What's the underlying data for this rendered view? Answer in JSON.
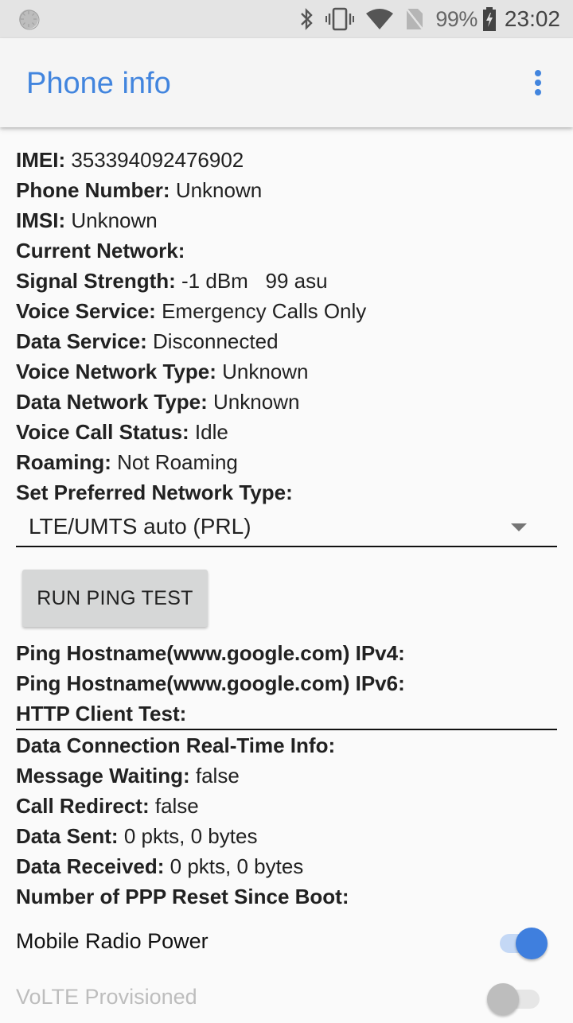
{
  "status_bar": {
    "left_icon": "sync-loading-icon",
    "icons": [
      "bluetooth-icon",
      "vibrate-icon",
      "wifi-icon",
      "no-sim-icon"
    ],
    "battery_percent": "99%",
    "battery_icon": "battery-charging-icon",
    "time": "23:02"
  },
  "app_bar": {
    "title": "Phone info",
    "overflow_icon": "more-vert-icon",
    "accent_color": "#4285de"
  },
  "info_rows": [
    {
      "label": "IMEI:",
      "value": "353394092476902"
    },
    {
      "label": "Phone Number:",
      "value": "Unknown"
    },
    {
      "label": "IMSI:",
      "value": "Unknown"
    },
    {
      "label": "Current Network:",
      "value": ""
    },
    {
      "label": "Signal Strength:",
      "value": "-1 dBm   99 asu"
    },
    {
      "label": "Voice Service:",
      "value": "Emergency Calls Only"
    },
    {
      "label": "Data Service:",
      "value": "Disconnected"
    },
    {
      "label": "Voice Network Type:",
      "value": "Unknown"
    },
    {
      "label": "Data Network Type:",
      "value": "Unknown"
    },
    {
      "label": "Voice Call Status:",
      "value": "Idle"
    },
    {
      "label": "Roaming:",
      "value": "Not Roaming"
    },
    {
      "label": "Set Preferred Network Type:",
      "value": ""
    }
  ],
  "preferred_network": {
    "selected": "LTE/UMTS auto (PRL)"
  },
  "ping_button": {
    "label": "RUN PING TEST"
  },
  "ping_rows": [
    {
      "label": "Ping Hostname(www.google.com) IPv4:",
      "value": ""
    },
    {
      "label": "Ping Hostname(www.google.com) IPv6:",
      "value": ""
    },
    {
      "label": "HTTP Client Test:",
      "value": ""
    }
  ],
  "realtime_rows": [
    {
      "label": "Data Connection Real-Time Info:",
      "value": ""
    },
    {
      "label": "Message Waiting:",
      "value": "false"
    },
    {
      "label": "Call Redirect:",
      "value": "false"
    },
    {
      "label": "Data Sent:",
      "value": "0 pkts, 0 bytes"
    },
    {
      "label": "Data Received:",
      "value": "0 pkts, 0 bytes"
    },
    {
      "label": "Number of PPP Reset Since Boot:",
      "value": ""
    }
  ],
  "toggles": [
    {
      "label": "Mobile Radio Power",
      "on": true,
      "enabled": true
    },
    {
      "label": "VoLTE Provisioned",
      "on": false,
      "enabled": false
    }
  ]
}
